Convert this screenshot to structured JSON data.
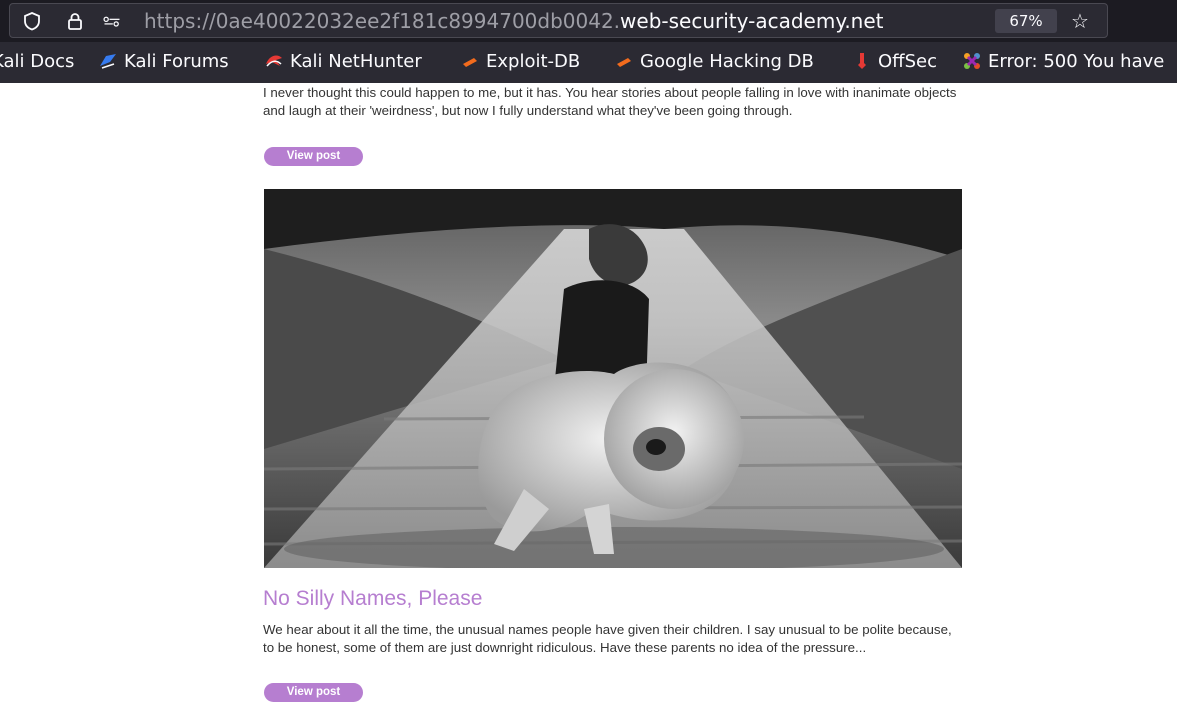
{
  "browser": {
    "url_prefix": "https://0ae40022032ee2f181c8994700db0042.",
    "url_domain": "web-security-academy.net",
    "zoom": "67%"
  },
  "bookmarks": [
    {
      "label": "Kali Docs",
      "icon": "kali-docs-icon"
    },
    {
      "label": "Kali Forums",
      "icon": "kali-forums-icon"
    },
    {
      "label": "Kali NetHunter",
      "icon": "kali-nethunter-icon"
    },
    {
      "label": "Exploit-DB",
      "icon": "exploit-db-icon"
    },
    {
      "label": "Google Hacking DB",
      "icon": "google-hacking-db-icon"
    },
    {
      "label": "OffSec",
      "icon": "offsec-icon"
    },
    {
      "label": "Error: 500 You have",
      "icon": "joomla-icon"
    }
  ],
  "posts": [
    {
      "excerpt": "I never thought this could happen to me, but it has. You hear stories about people falling in love with inanimate objects and laugh at their 'weirdness', but now I fully understand what they've been going through.",
      "button": "View post"
    },
    {
      "title": "No Silly Names, Please",
      "excerpt": "We hear about it all the time, the unusual names people have given their children. I say unusual to be polite because, to be honest, some of them are just downright ridiculous. Have these parents no idea of the pressure...",
      "button": "View post"
    }
  ],
  "colors": {
    "accent": "#b67ed0",
    "chrome_dark": "#1c1b22",
    "chrome_bar": "#2b2a33"
  }
}
